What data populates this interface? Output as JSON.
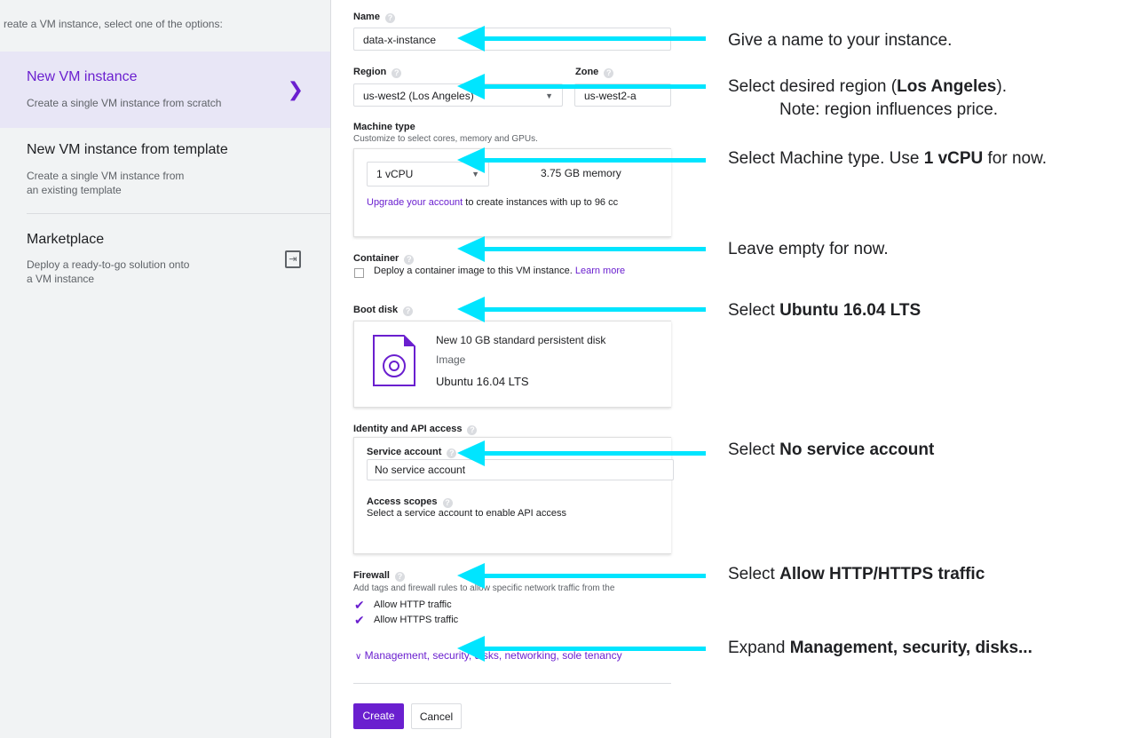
{
  "sidebar": {
    "intro": "reate a VM instance, select one of the options:",
    "options": [
      {
        "title": "New VM instance",
        "desc": "Create a single VM instance from scratch"
      },
      {
        "title": "New VM instance from template",
        "desc_lines": [
          "Create a single VM instance from",
          "an existing template"
        ]
      },
      {
        "title": "Marketplace",
        "desc_lines": [
          "Deploy a ready-to-go solution onto",
          "a VM instance"
        ]
      }
    ]
  },
  "form": {
    "name_label": "Name",
    "name_value": "data-x-instance",
    "region_label": "Region",
    "region_value": "us-west2 (Los Angeles)",
    "zone_label": "Zone",
    "zone_value": "us-west2-a",
    "machine_label": "Machine type",
    "machine_sub": "Customize to select cores, memory and GPUs.",
    "machine_value": "1 vCPU",
    "memory": "3.75 GB memory",
    "upgrade_link": "Upgrade your account",
    "upgrade_text": " to create instances with up to 96 cc",
    "container_label": "Container",
    "container_text": "Deploy a container image to this VM instance.",
    "container_link": "Learn more",
    "boot_label": "Boot disk",
    "boot_disk": "New 10 GB standard persistent disk",
    "boot_image_label": "Image",
    "boot_image": "Ubuntu 16.04 LTS",
    "identity_label": "Identity and API access",
    "service_label": "Service account",
    "service_value": "No service account",
    "scopes_label": "Access scopes",
    "scopes_text": "Select a service account to enable API access",
    "firewall_label": "Firewall",
    "firewall_sub": "Add tags and firewall rules to allow specific network traffic from the",
    "http": "Allow HTTP traffic",
    "https": "Allow HTTPS traffic",
    "expand_link": "Management, security, disks, networking, sole tenancy",
    "create": "Create",
    "cancel": "Cancel"
  },
  "annotations": {
    "name": "Give a name to your instance.",
    "region_pre": "Select desired region (",
    "region_bold": "Los Angeles",
    "region_post": ").",
    "region_note": "Note: region influences price.",
    "machine_pre": "Select Machine type. Use ",
    "machine_bold": "1 vCPU",
    "machine_post": " for now.",
    "container": "Leave empty for now.",
    "boot_pre": "Select ",
    "boot_bold": "Ubuntu 16.04 LTS",
    "service_pre": "Select ",
    "service_bold": "No service account",
    "firewall_pre": "Select ",
    "firewall_bold": "Allow HTTP/HTTPS traffic",
    "expand_pre": "Expand ",
    "expand_bold": "Management, security, disks..."
  },
  "colors": {
    "accent": "#6a1fcf",
    "arrow": "#00e5ff",
    "sidebar_bg": "#f1f3f4",
    "selected_bg": "#e8e6f6"
  }
}
